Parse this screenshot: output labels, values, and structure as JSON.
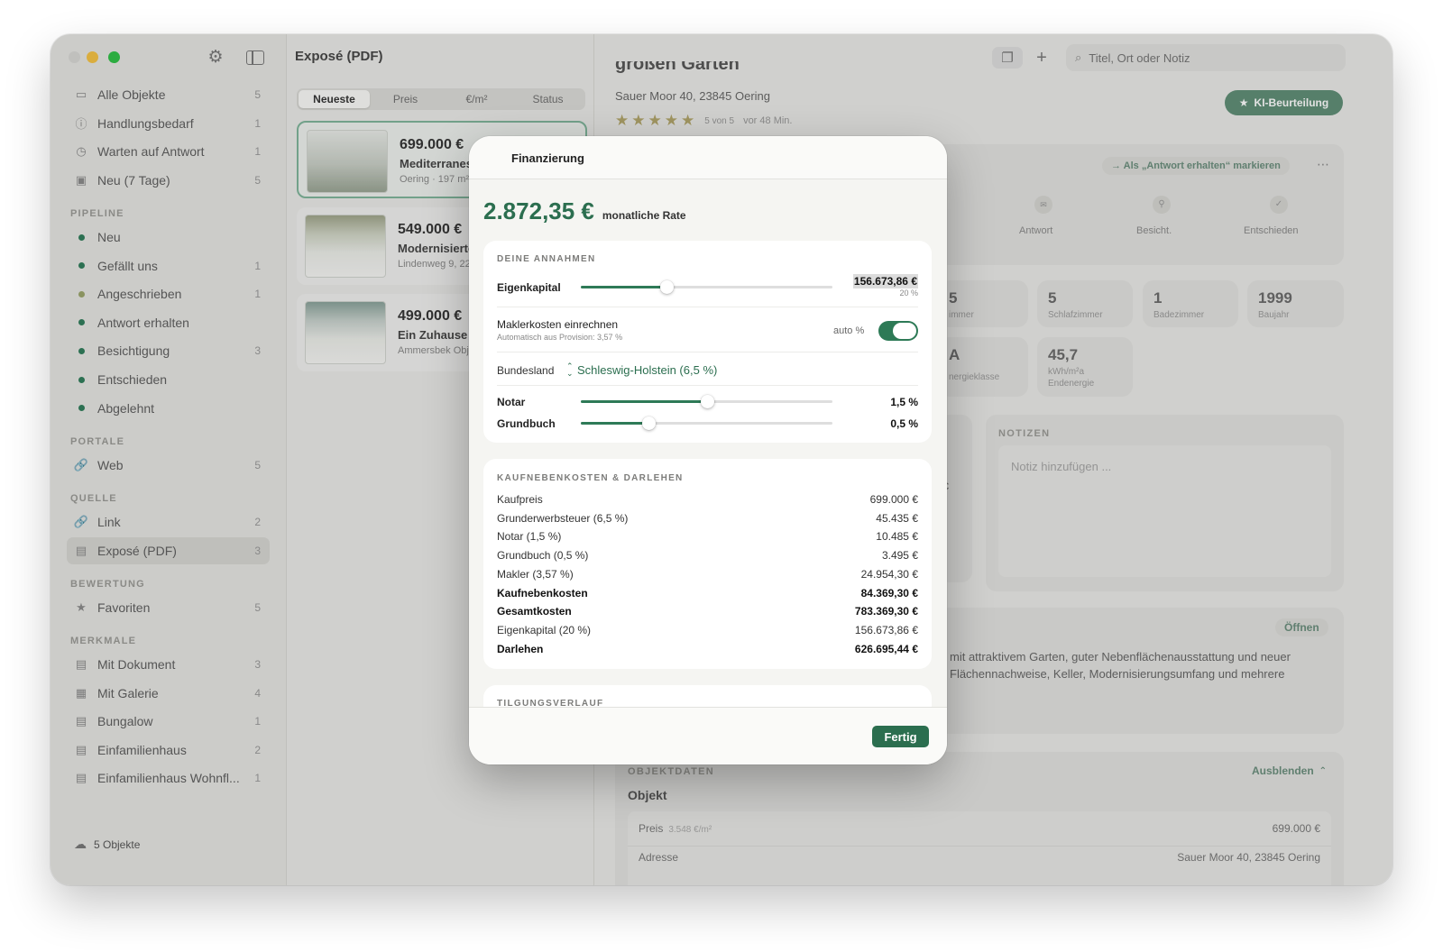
{
  "sidebar": {
    "items_top": [
      {
        "label": "Alle Objekte",
        "count": "5",
        "icon": "building-icon"
      },
      {
        "label": "Handlungsbedarf",
        "count": "1",
        "icon": "exclamation-icon"
      },
      {
        "label": "Warten auf Antwort",
        "count": "1",
        "icon": "clock-icon"
      },
      {
        "label": "Neu (7 Tage)",
        "count": "5",
        "icon": "calendar-icon"
      }
    ],
    "pipeline_title": "PIPELINE",
    "pipeline": [
      {
        "label": "Neu",
        "count": ""
      },
      {
        "label": "Gefällt uns",
        "count": "1"
      },
      {
        "label": "Angeschrieben",
        "count": "1"
      },
      {
        "label": "Antwort erhalten",
        "count": ""
      },
      {
        "label": "Besichtigung",
        "count": "3"
      },
      {
        "label": "Entschieden",
        "count": ""
      },
      {
        "label": "Abgelehnt",
        "count": ""
      }
    ],
    "portale_title": "PORTALE",
    "portale": [
      {
        "label": "Web",
        "count": "5"
      }
    ],
    "quelle_title": "QUELLE",
    "quelle": [
      {
        "label": "Link",
        "count": "2"
      },
      {
        "label": "Exposé (PDF)",
        "count": "3"
      }
    ],
    "bewertung_title": "BEWERTUNG",
    "bewertung": [
      {
        "label": "Favoriten",
        "count": "5"
      }
    ],
    "merkmale_title": "MERKMALE",
    "merkmale": [
      {
        "label": "Mit Dokument",
        "count": "3"
      },
      {
        "label": "Mit Galerie",
        "count": "4"
      },
      {
        "label": "Bungalow",
        "count": "1"
      },
      {
        "label": "Einfamilienhaus",
        "count": "2"
      },
      {
        "label": "Einfamilienhaus Wohnfl...",
        "count": "1"
      }
    ],
    "footer": "5 Objekte"
  },
  "toolbar": {
    "title": "Exposé (PDF)",
    "search_placeholder": "Titel, Ort oder Notiz"
  },
  "list": {
    "tabs": [
      "Neueste",
      "Preis",
      "€/m²",
      "Status"
    ],
    "cards": [
      {
        "price": "699.000 €",
        "title": "Mediterranes E",
        "sub": "Oering · 197 m²"
      },
      {
        "price": "549.000 €",
        "title": "Modernisiertes",
        "sub": "Lindenweg 9, 22"
      },
      {
        "price": "499.000 €",
        "title": "Ein Zuhause m",
        "sub": "Ammersbek Obj"
      }
    ]
  },
  "detail": {
    "title_partial": "großen Garten",
    "address": "Sauer Moor 40, 23845 Oering",
    "rating_text": "5 von 5",
    "time": "vor 48 Min.",
    "ki_button": "KI-Beurteilung",
    "mark_button": "→ Als „Antwort erhalten“ markieren",
    "steps": [
      "Antwort",
      "Besicht.",
      "Entschieden"
    ],
    "stats": [
      {
        "value": "5",
        "label": "immer"
      },
      {
        "value": "5",
        "label": "Schlafzimmer"
      },
      {
        "value": "1",
        "label": "Badezimmer"
      },
      {
        "value": "1999",
        "label": "Baujahr"
      },
      {
        "value": "A",
        "label": "nergieklasse"
      },
      {
        "value": "45,7",
        "label": "kWh/m²a\nEndenergie"
      }
    ],
    "notes_title": "NOTIZEN",
    "notes_placeholder": "Notiz hinzufügen ...",
    "desc_open": "Öffnen",
    "desc_line1": "mit attraktivem Garten, guter Nebenflächenausstattung und neuer",
    "desc_line2": "Flächennachweise, Keller, Modernisierungsumfang und mehrere",
    "objektdaten_title": "OBJEKTDATEN",
    "objektdaten_toggle": "Ausblenden",
    "objekt_label": "Objekt",
    "preis_label": "Preis",
    "preis_sub": "3.548 €/m²",
    "preis_value": "699.000 €",
    "adresse_label": "Adresse",
    "adresse_value": "Sauer Moor 40, 23845 Oering"
  },
  "modal": {
    "title": "Finanzierung",
    "rate": "2.872,35 €",
    "rate_label": "monatliche Rate",
    "assumptions_title": "DEINE ANNAHMEN",
    "eigenkapital_label": "Eigenkapital",
    "eigenkapital_value": "156.673,86 €",
    "eigenkapital_pct": "20 %",
    "eigenkapital_fraction": 0.34,
    "makler_label": "Maklerkosten einrechnen",
    "makler_sub": "Automatisch aus Provision: 3,57 %",
    "makler_auto": "auto %",
    "makler_on": true,
    "bundesland_label": "Bundesland",
    "bundesland_value": "Schleswig-Holstein (6,5 %)",
    "notar_label": "Notar",
    "notar_value": "1,5 %",
    "notar_fraction": 0.5,
    "grundbuch_label": "Grundbuch",
    "grundbuch_value": "0,5 %",
    "grundbuch_fraction": 0.27,
    "costs_title": "KAUFNEBENKOSTEN & DARLEHEN",
    "costs": [
      {
        "label": "Kaufpreis",
        "value": "699.000 €",
        "bold": false
      },
      {
        "label": "Grunderwerbsteuer (6,5 %)",
        "value": "45.435 €",
        "bold": false
      },
      {
        "label": "Notar (1,5 %)",
        "value": "10.485 €",
        "bold": false
      },
      {
        "label": "Grundbuch (0,5 %)",
        "value": "3.495 €",
        "bold": false
      },
      {
        "label": "Makler (3,57 %)",
        "value": "24.954,30 €",
        "bold": false
      },
      {
        "label": "Kaufnebenkosten",
        "value": "84.369,30 €",
        "bold": true
      },
      {
        "label": "Gesamtkosten",
        "value": "783.369,30 €",
        "bold": true
      },
      {
        "label": "Eigenkapital (20 %)",
        "value": "156.673,86 €",
        "bold": false
      },
      {
        "label": "Darlehen",
        "value": "626.695,44 €",
        "bold": true
      }
    ],
    "tilgung_title": "TILGUNGSVERLAUF",
    "done_button": "Fertig"
  },
  "colors": {
    "accent": "#2b6e4f",
    "accent_light": "#2e7a57",
    "window_bg": "#ebebe8"
  }
}
